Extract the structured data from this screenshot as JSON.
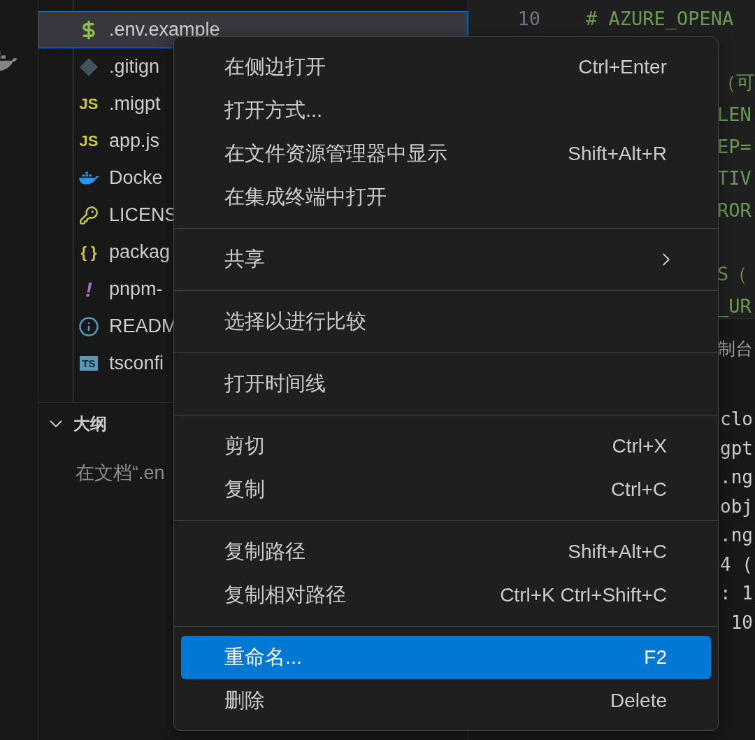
{
  "explorer": {
    "files": [
      {
        "name": ".env.example",
        "kind": "dollar",
        "selected": true
      },
      {
        "name": ".gitign",
        "kind": "git",
        "selected": false
      },
      {
        "name": ".migpt",
        "kind": "glyph",
        "glyph": "JS",
        "selected": false
      },
      {
        "name": "app.js",
        "kind": "glyph",
        "glyph": "JS",
        "selected": false
      },
      {
        "name": "Docke",
        "kind": "docker",
        "selected": false
      },
      {
        "name": "LICENS",
        "kind": "key",
        "selected": false
      },
      {
        "name": "packag",
        "kind": "glyph",
        "glyph": "{ }",
        "selected": false
      },
      {
        "name": "pnpm-",
        "kind": "bang",
        "glyph": "!",
        "selected": false
      },
      {
        "name": "READM",
        "kind": "info",
        "selected": false
      },
      {
        "name": "tsconfi",
        "kind": "tsbox",
        "glyph": "TS",
        "selected": false
      }
    ]
  },
  "outline": {
    "title": "大纲",
    "expanded": true,
    "message": "在文档“.en"
  },
  "editor": {
    "lines": [
      {
        "kind": "line",
        "number": "10",
        "text": "# AZURE_OPENA"
      },
      {
        "kind": "blank"
      },
      {
        "kind": "fragment",
        "text": "（可"
      },
      {
        "kind": "fragment",
        "text": "LEN"
      },
      {
        "kind": "fragment",
        "text": "EP="
      },
      {
        "kind": "fragment",
        "text": "TIV"
      },
      {
        "kind": "fragment",
        "text": "ROR"
      },
      {
        "kind": "blank"
      },
      {
        "kind": "fragment",
        "text": "S（"
      },
      {
        "kind": "fragment",
        "text": "_UR"
      }
    ]
  },
  "panel": {
    "tab": "制台",
    "lines": [
      "clo",
      "gpt",
      ".ng",
      "obj",
      ".ng",
      "4 (",
      ": 1",
      " 10"
    ]
  },
  "context_menu": {
    "groups": [
      [
        {
          "label": "在侧边打开",
          "shortcut": "Ctrl+Enter",
          "selected": false
        },
        {
          "label": "打开方式...",
          "selected": false
        },
        {
          "label": "在文件资源管理器中显示",
          "shortcut": "Shift+Alt+R",
          "selected": false
        },
        {
          "label": "在集成终端中打开",
          "selected": false
        }
      ],
      [
        {
          "label": "共享",
          "submenu": true,
          "selected": false
        }
      ],
      [
        {
          "label": "选择以进行比较",
          "selected": false
        }
      ],
      [
        {
          "label": "打开时间线",
          "selected": false
        }
      ],
      [
        {
          "label": "剪切",
          "shortcut": "Ctrl+X",
          "selected": false
        },
        {
          "label": "复制",
          "shortcut": "Ctrl+C",
          "selected": false
        }
      ],
      [
        {
          "label": "复制路径",
          "shortcut": "Shift+Alt+C",
          "selected": false
        },
        {
          "label": "复制相对路径",
          "shortcut": "Ctrl+K Ctrl+Shift+C",
          "selected": false
        }
      ],
      [
        {
          "label": "重命名...",
          "shortcut": "F2",
          "selected": true
        },
        {
          "label": "删除",
          "shortcut": "Delete",
          "selected": false
        }
      ]
    ]
  }
}
